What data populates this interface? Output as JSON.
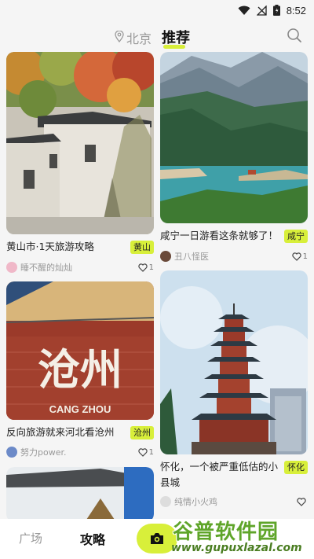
{
  "status_bar": {
    "time": "8:52"
  },
  "top_tabs": {
    "city": "北京",
    "recommend": "推荐"
  },
  "feed": {
    "left": [
      {
        "title": "黄山市·1天旅游攻略",
        "tag": "黄山",
        "author": "睡不醒的灿灿",
        "likes": "1",
        "image": "huizhou-village-autumn"
      },
      {
        "title": "反向旅游就来河北看沧州",
        "tag": "沧州",
        "author": "努力power.",
        "likes": "1",
        "image": "cangzhou-sign",
        "sign_text": "沧州",
        "sign_sub": "CANG ZHOU"
      },
      {
        "image": "white-wall-roof"
      }
    ],
    "right": [
      {
        "title": "咸宁一日游看这条就够了！",
        "tag": "咸宁",
        "author": "丑八怪医",
        "likes": "1",
        "image": "xianning-lake-mountains"
      },
      {
        "title_line1": "怀化，一个被严重低估的小",
        "title_line2": "县城",
        "tag": "怀化",
        "author": "纯情小火鸡",
        "likes": "",
        "image": "huaihua-pagoda"
      }
    ]
  },
  "bottom_nav": {
    "square": "广场",
    "guide": "攻略"
  },
  "watermark": {
    "title": "谷普软件园",
    "url": "www.gupuxlazal.com"
  },
  "colors": {
    "accent": "#d8ef3a"
  }
}
